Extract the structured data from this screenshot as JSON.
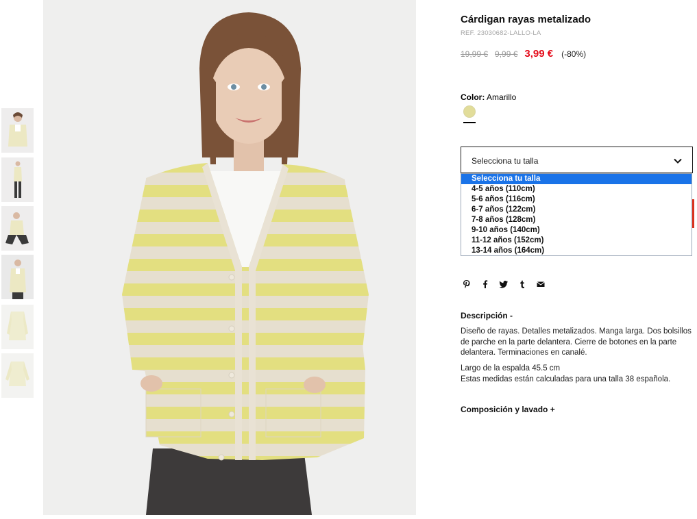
{
  "product": {
    "title": "Cárdigan rayas metalizado",
    "ref": "REF. 23030682-LALLO-LA",
    "prices": {
      "original": "19,99 €",
      "previous": "9,99 €",
      "current": "3,99 €",
      "discount": "(-80%)"
    },
    "color": {
      "label": "Color:",
      "value": "Amarillo",
      "swatch_color": "#e2dd9a"
    }
  },
  "size_select": {
    "selected": "Selecciona tu talla",
    "options": [
      "Selecciona tu talla",
      "4-5 años (110cm)",
      "5-6 años (116cm)",
      "6-7 años (122cm)",
      "7-8 años (128cm)",
      "9-10 años (140cm)",
      "11-12 años (152cm)",
      "13-14 años (164cm)"
    ]
  },
  "share": {
    "icons": [
      "pinterest-icon",
      "facebook-icon",
      "twitter-icon",
      "tumblr-icon",
      "email-icon"
    ]
  },
  "description": {
    "heading": "Descripción -",
    "text": "Diseño de rayas. Detalles metalizados. Manga larga. Dos bolsillos de parche en la parte delantera. Cierre de botones en la parte delantera. Terminaciones en canalé.",
    "measure_1": "Largo de la espalda 45.5 cm",
    "measure_2": "Estas medidas están calculadas para una talla 38 española."
  },
  "composition": {
    "heading": "Composición y lavado +"
  },
  "colors": {
    "accent_red": "#e40b1a",
    "select_highlight": "#1a73e8",
    "stripe_yellow": "#e3e07a",
    "stripe_beige": "#e8e1d4"
  }
}
